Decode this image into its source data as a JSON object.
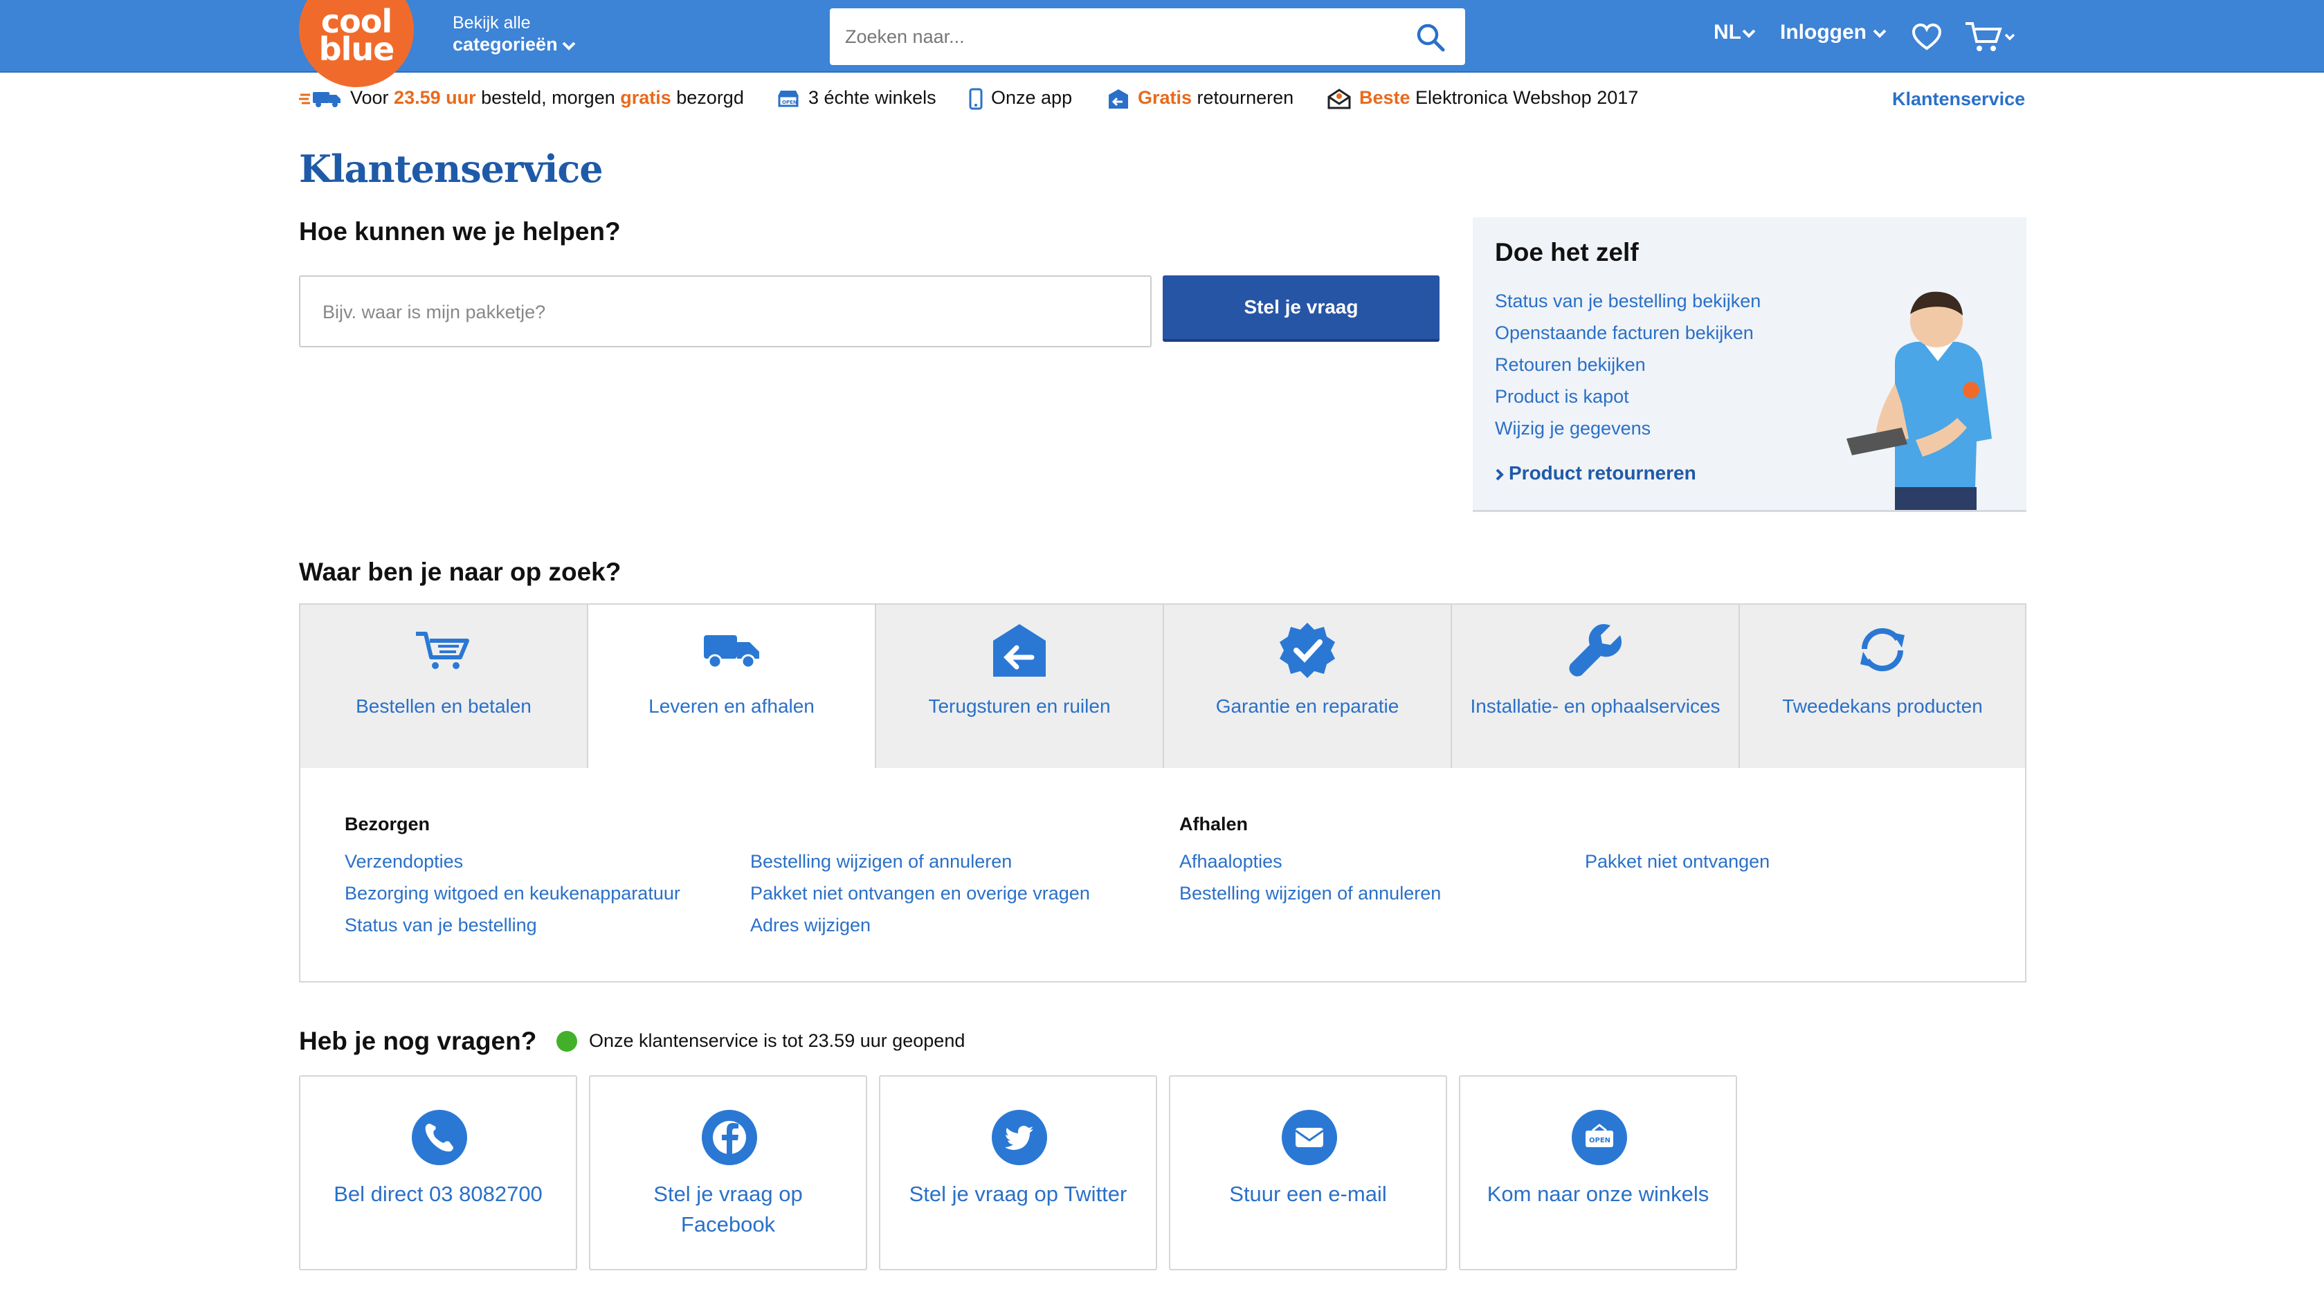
{
  "header": {
    "logo_line1": "cool",
    "logo_line2": "blue",
    "categories_line1": "Bekijk alle",
    "categories_line2": "categorieën",
    "search_placeholder": "Zoeken naar...",
    "language": "NL",
    "login": "Inloggen"
  },
  "usp": {
    "item1_prefix": "Voor ",
    "item1_time": "23.59 uur",
    "item1_middle": " besteld, morgen ",
    "item1_free": "gratis",
    "item1_suffix": " bezorgd",
    "item2": "3 échte winkels",
    "item3": "Onze app",
    "item4_free": "Gratis",
    "item4_suffix": " retourneren",
    "item5_best": "Beste",
    "item5_suffix": " Elektronica Webshop 2017",
    "customer_service_link": "Klantenservice"
  },
  "page": {
    "title": "Klantenservice",
    "help_heading": "Hoe kunnen we je helpen?",
    "ask_placeholder": "Bijv. waar is mijn pakketje?",
    "ask_button": "Stel je vraag"
  },
  "diy": {
    "title": "Doe het zelf",
    "links": [
      "Status van je bestelling bekijken",
      "Openstaande facturen bekijken",
      "Retouren bekijken",
      "Product is kapot",
      "Wijzig je gegevens"
    ],
    "cta": "Product retourneren"
  },
  "search_section": {
    "heading": "Waar ben je naar op zoek?",
    "tabs": [
      {
        "label": "Bestellen en betalen",
        "icon": "cart-icon"
      },
      {
        "label": "Leveren en afhalen",
        "icon": "truck-icon"
      },
      {
        "label": "Terugsturen en ruilen",
        "icon": "return-box-icon"
      },
      {
        "label": "Garantie en reparatie",
        "icon": "badge-check-icon"
      },
      {
        "label": "Installatie- en ophaalservices",
        "icon": "wrench-icon"
      },
      {
        "label": "Tweedekans producten",
        "icon": "refresh-icon"
      }
    ],
    "active_tab": "Leveren en afhalen",
    "panel": {
      "bezorgen_title": "Bezorgen",
      "bezorgen_col1": [
        "Verzendopties",
        "Bezorging witgoed en keukenapparatuur",
        "Status van je bestelling"
      ],
      "bezorgen_col2": [
        "Bestelling wijzigen of annuleren",
        "Pakket niet ontvangen en overige vragen",
        "Adres wijzigen"
      ],
      "afhalen_title": "Afhalen",
      "afhalen_col1": [
        "Afhaalopties",
        "Bestelling wijzigen of annuleren"
      ],
      "afhalen_col2": [
        "Pakket niet ontvangen"
      ]
    }
  },
  "contact": {
    "heading": "Heb je nog vragen?",
    "status": "Onze klantenservice is tot 23.59 uur geopend",
    "status_color": "#43b02a",
    "cards": [
      {
        "label": "Bel direct 03 8082700",
        "icon": "phone-icon"
      },
      {
        "label": "Stel je vraag op Facebook",
        "icon": "facebook-icon"
      },
      {
        "label": "Stel je vraag op Twitter",
        "icon": "twitter-icon"
      },
      {
        "label": "Stuur een e-mail",
        "icon": "mail-icon"
      },
      {
        "label": "Kom naar onze winkels",
        "icon": "store-open-icon"
      }
    ]
  },
  "colors": {
    "header_blue": "#3d83d6",
    "logo_orange": "#f06b2b",
    "link_blue": "#2a70c8",
    "button_blue": "#2755a6",
    "accent_orange": "#e86a1c"
  }
}
